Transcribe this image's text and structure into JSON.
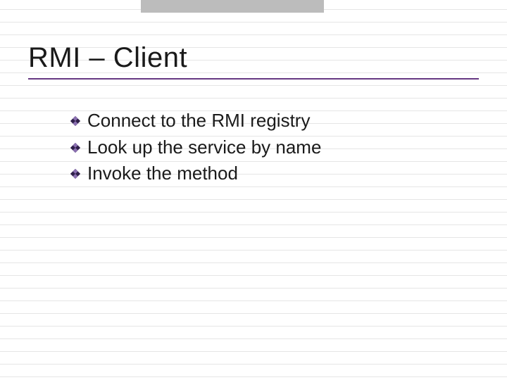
{
  "slide": {
    "title": "RMI – Client",
    "bullets": [
      "Connect to the RMI registry",
      "Look up the service by name",
      "Invoke the method"
    ]
  },
  "colors": {
    "accent": "#663883",
    "bulletDark": "#2f1f4a"
  }
}
